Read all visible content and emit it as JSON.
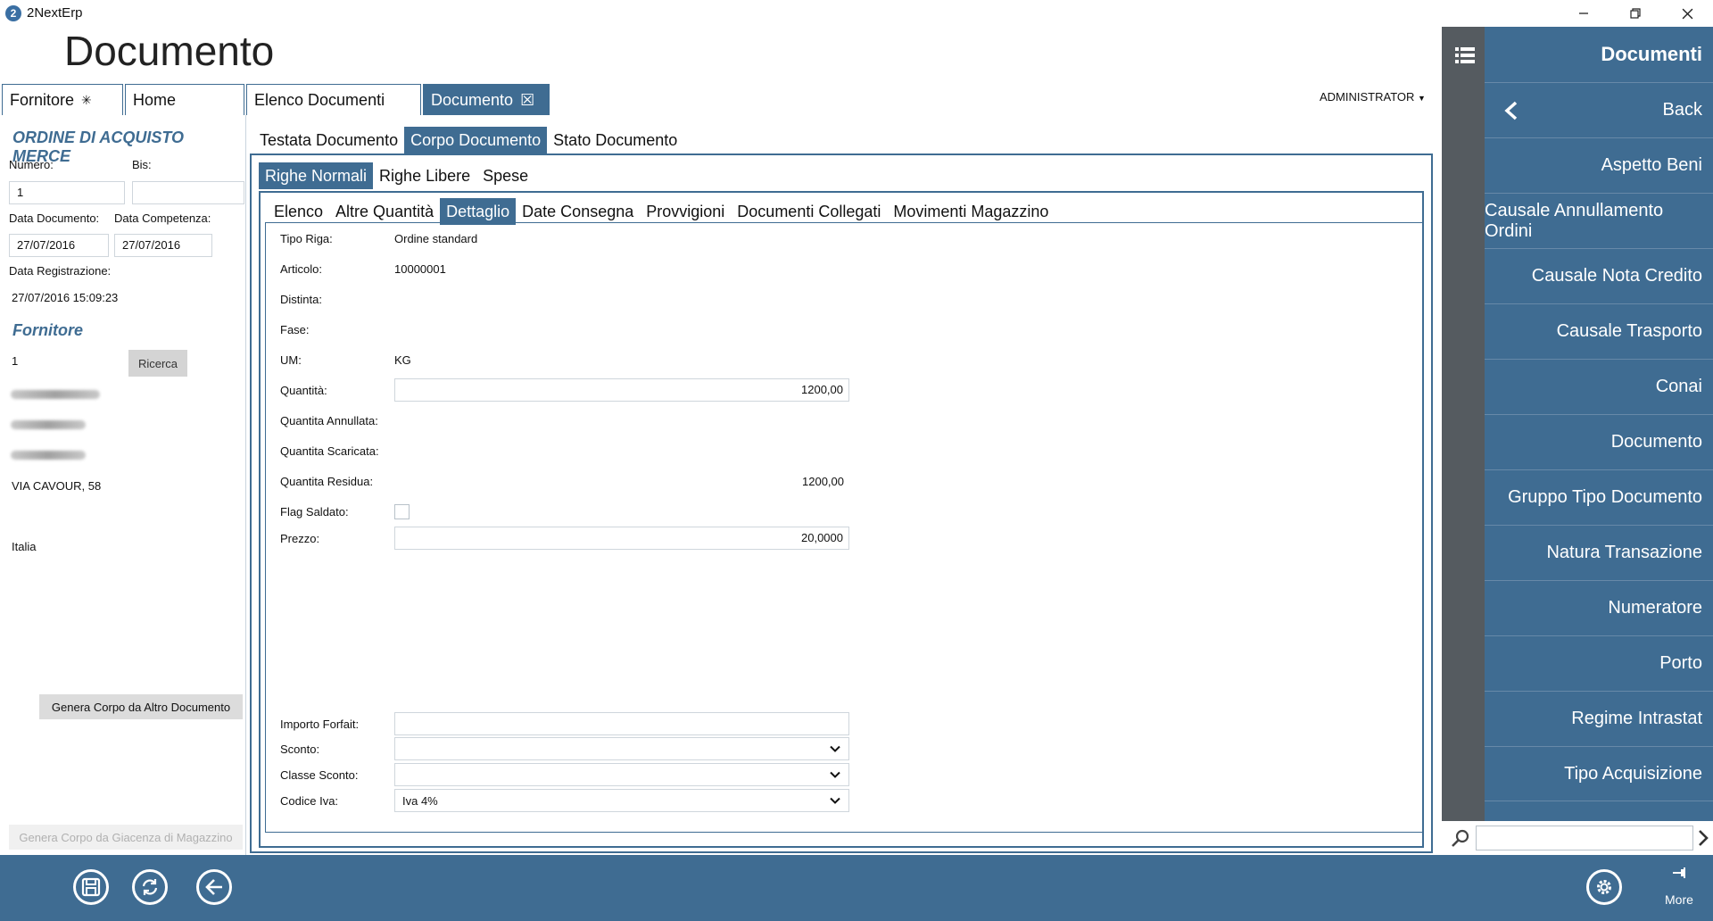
{
  "app": {
    "name": "2NextErp",
    "logo_letter": "2",
    "page_title": "Documento"
  },
  "top_tabs": [
    {
      "label": "Fornitore",
      "pinned_icon": "✳"
    },
    {
      "label": "Home"
    },
    {
      "label": "Elenco Documenti"
    },
    {
      "label": "Documento",
      "close_icon": "☒"
    }
  ],
  "user": {
    "name": "ADMINISTRATOR",
    "caret": "▼"
  },
  "left": {
    "heading": "ORDINE DI ACQUISTO MERCE",
    "numero_label": "Numero:",
    "numero_value": "1",
    "bis_label": "Bis:",
    "bis_value": "",
    "data_doc_label": "Data Documento:",
    "data_doc_value": "27/07/2016",
    "data_comp_label": "Data Competenza:",
    "data_comp_value": "27/07/2016",
    "data_reg_label": "Data Registrazione:",
    "data_reg_value": "27/07/2016 15:09:23",
    "fornitore_heading": "Fornitore",
    "fornitore_code": "1",
    "ricerca_label": "Ricerca",
    "address": "VIA CAVOUR, 58",
    "country": "Italia",
    "genera_altro_label": "Genera Corpo da Altro Documento",
    "genera_giacenza_label": "Genera Corpo da Giacenza di Magazzino"
  },
  "level1_tabs": [
    "Testata Documento",
    "Corpo Documento",
    "Stato Documento"
  ],
  "level2_tabs": [
    "Righe Normali",
    "Righe Libere",
    "Spese"
  ],
  "level3_tabs": [
    "Elenco",
    "Altre Quantità",
    "Dettaglio",
    "Date Consegna",
    "Provvigioni",
    "Documenti Collegati",
    "Movimenti Magazzino"
  ],
  "detail": {
    "tipo_riga_label": "Tipo Riga:",
    "tipo_riga_value": "Ordine standard",
    "articolo_label": "Articolo:",
    "articolo_value": "10000001",
    "distinta_label": "Distinta:",
    "fase_label": "Fase:",
    "um_label": "UM:",
    "um_value": "KG",
    "quantita_label": "Quantità:",
    "quantita_value": "1200,00",
    "q_annullata_label": "Quantita Annullata:",
    "q_scaricata_label": "Quantita Scaricata:",
    "q_residua_label": "Quantita Residua:",
    "q_residua_value": "1200,00",
    "flag_saldato_label": "Flag Saldato:",
    "prezzo_label": "Prezzo:",
    "prezzo_value": "20,0000",
    "importo_forfait_label": "Importo Forfait:",
    "importo_forfait_value": "",
    "sconto_label": "Sconto:",
    "sconto_value": "",
    "classe_sconto_label": "Classe Sconto:",
    "classe_sconto_value": "",
    "codice_iva_label": "Codice Iva:",
    "codice_iva_value": "Iva 4%"
  },
  "side_panel": {
    "title": "Documenti",
    "items": [
      "Back",
      "Aspetto Beni",
      "Causale Annullamento Ordini",
      "Causale Nota Credito",
      "Causale Trasporto",
      "Conai",
      "Documento",
      "Gruppo Tipo Documento",
      "Natura Transazione",
      "Numeratore",
      "Porto",
      "Regime Intrastat",
      "Tipo Acquisizione"
    ]
  },
  "bottom": {
    "more_label": "More"
  },
  "colors": {
    "accent": "#3f6c92",
    "dark_strip": "#555b60"
  }
}
